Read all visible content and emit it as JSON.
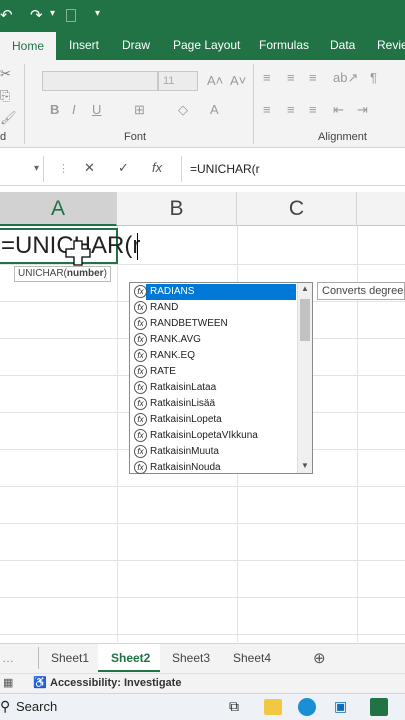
{
  "qat": {
    "undo_glyph": "↶",
    "redo_glyph": "↷",
    "dropdown_glyph": "▾"
  },
  "tabs": [
    "Home",
    "Insert",
    "Draw",
    "Page Layout",
    "Formulas",
    "Data",
    "Revie"
  ],
  "ribbon": {
    "font_group": "Font",
    "alignment_group": "Alignment",
    "font_size": "11",
    "bold": "B",
    "italic": "I",
    "underline": "U",
    "clipboard_label": "d"
  },
  "formula_bar": {
    "cancel": "✕",
    "enter": "✓",
    "fx": "fx",
    "value": "=UNICHAR(r"
  },
  "columns": [
    "A",
    "B",
    "C"
  ],
  "cell": {
    "value": "=UNICHAR(r"
  },
  "tooltip": {
    "fn": "UNICHAR(",
    "arg": "number",
    ")": ")"
  },
  "tooltip_text": "UNICHAR(number)",
  "autocomplete": {
    "items": [
      "RADIANS",
      "RAND",
      "RANDBETWEEN",
      "RANK.AVG",
      "RANK.EQ",
      "RATE",
      "RatkaisinLataa",
      "RatkaisinLisää",
      "RatkaisinLopeta",
      "RatkaisinLopetaVIkkuna",
      "RatkaisinMuuta",
      "RatkaisinNouda"
    ],
    "selected": 0,
    "description": "Converts degrees"
  },
  "sheets": [
    "Sheet1",
    "Sheet2",
    "Sheet3",
    "Sheet4"
  ],
  "active_sheet": 1,
  "status": {
    "accessibility": "Accessibility: Investigate"
  },
  "taskbar": {
    "search": "Search"
  },
  "colors": {
    "excel_green": "#217346",
    "selection_blue": "#0078d7"
  }
}
